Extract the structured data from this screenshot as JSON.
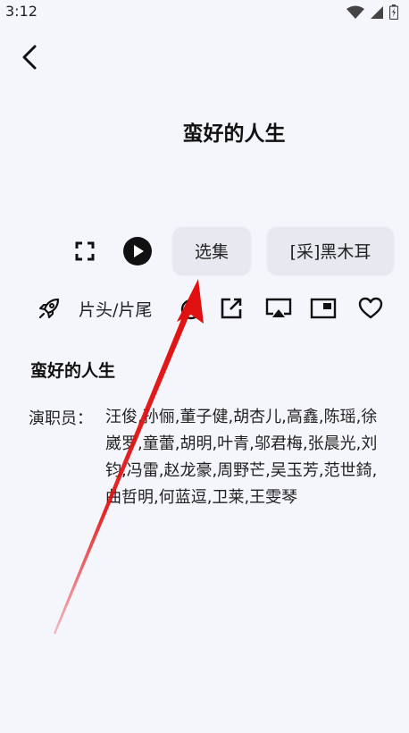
{
  "status_bar": {
    "time": "3:12",
    "icons": [
      "wifi-icon",
      "signal-icon",
      "battery-icon"
    ]
  },
  "header": {
    "back_icon": "chevron-left-icon"
  },
  "title": "蛮好的人生",
  "controls": {
    "fullscreen_icon": "fullscreen-icon",
    "play_icon": "play-icon",
    "episodes_label": "选集",
    "source_label": "[采]黑木耳"
  },
  "actions": {
    "skip_icon": "rocket-icon",
    "skip_label": "片头/片尾",
    "timer_icon": "timer-icon",
    "external_icon": "external-open-icon",
    "cast_icon": "cast-icon",
    "pip_icon": "picture-in-picture-icon",
    "favorite_icon": "heart-icon"
  },
  "info": {
    "title": "蛮好的人生",
    "cast_label": "演职员：",
    "cast": "汪俊,孙俪,董子健,胡杏儿,高鑫,陈瑶,徐崴罗,童蕾,胡明,叶青,邬君梅,张晨光,刘钧,冯雷,赵龙豪,周野芒,吴玉芳,范世錡,曲哲明,何蓝逗,卫莱,王雯琴"
  },
  "colors": {
    "background": "#f5f6fc",
    "pill": "#e8e9f0",
    "arrow": "#e01010"
  }
}
